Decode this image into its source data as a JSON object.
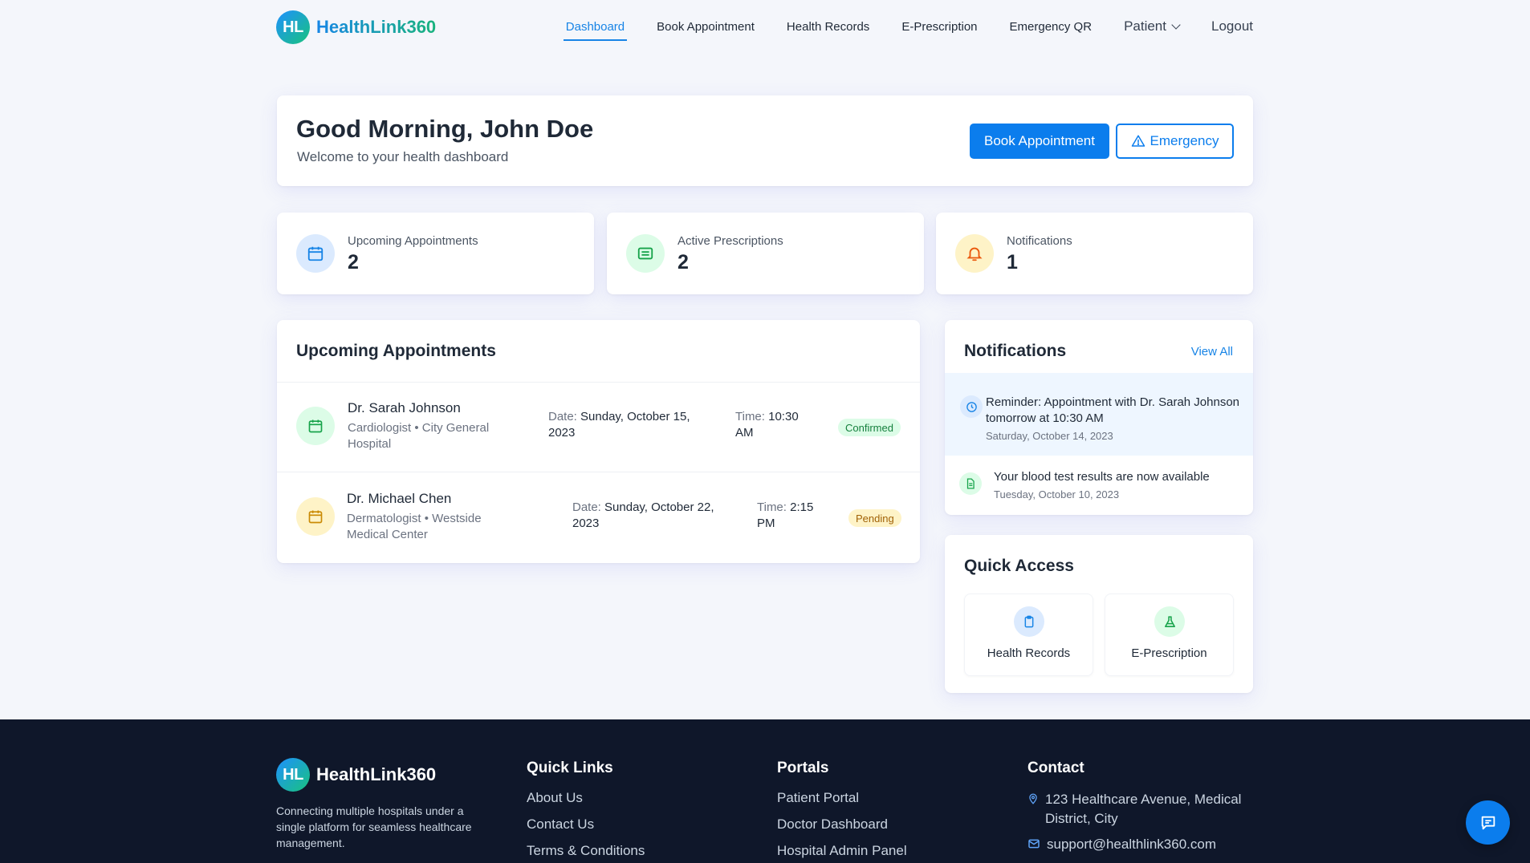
{
  "brand": {
    "logo_text": "HL",
    "name": "HealthLink360"
  },
  "nav": {
    "links": [
      "Dashboard",
      "Book Appointment",
      "Health Records",
      "E-Prescription",
      "Emergency QR"
    ],
    "patient_menu": "Patient",
    "logout": "Logout",
    "active": "Dashboard"
  },
  "welcome": {
    "greeting": "Good Morning, John Doe",
    "subtitle": "Welcome to your health dashboard",
    "book_button": "Book Appointment",
    "emergency_button": "Emergency"
  },
  "stats": [
    {
      "label": "Upcoming Appointments",
      "value": "2",
      "icon": "calendar-icon"
    },
    {
      "label": "Active Prescriptions",
      "value": "2",
      "icon": "prescription-icon"
    },
    {
      "label": "Notifications",
      "value": "1",
      "icon": "bell-icon"
    }
  ],
  "appointments": {
    "title": "Upcoming Appointments",
    "items": [
      {
        "doctor": "Dr. Sarah Johnson",
        "specialty": "Cardiologist • City General Hospital",
        "date_label": "Date:",
        "date": "Sunday, October 15, 2023",
        "time_label": "Time:",
        "time": "10:30 AM",
        "status": "Confirmed"
      },
      {
        "doctor": "Dr. Michael Chen",
        "specialty": "Dermatologist • Westside Medical Center",
        "date_label": "Date:",
        "date": "Sunday, October 22, 2023",
        "time_label": "Time:",
        "time": "2:15 PM",
        "status": "Pending"
      }
    ]
  },
  "notifications": {
    "title": "Notifications",
    "view_all": "View All",
    "items": [
      {
        "text": "Reminder: Appointment with Dr. Sarah Johnson tomorrow at 10:30 AM",
        "date": "Saturday, October 14, 2023",
        "icon": "clock-icon"
      },
      {
        "text": "Your blood test results are now available",
        "date": "Tuesday, October 10, 2023",
        "icon": "document-icon"
      }
    ]
  },
  "quick_access": {
    "title": "Quick Access",
    "items": [
      {
        "label": "Health Records",
        "icon": "clipboard-icon"
      },
      {
        "label": "E-Prescription",
        "icon": "flask-icon"
      }
    ]
  },
  "footer": {
    "description": "Connecting multiple hospitals under a single platform for seamless healthcare management.",
    "quick_links": {
      "title": "Quick Links",
      "items": [
        "About Us",
        "Contact Us",
        "Terms & Conditions"
      ]
    },
    "portals": {
      "title": "Portals",
      "items": [
        "Patient Portal",
        "Doctor Dashboard",
        "Hospital Admin Panel"
      ]
    },
    "contact": {
      "title": "Contact",
      "address": "123 Healthcare Avenue, Medical District, City",
      "email": "support@healthlink360.com"
    }
  },
  "colors": {
    "primary": "#0b7ded",
    "brand_gradient_start": "#1e90ff",
    "brand_gradient_end": "#19c37d",
    "footer_bg": "#0f172a",
    "confirmed": "#15803d",
    "pending": "#a16207"
  }
}
